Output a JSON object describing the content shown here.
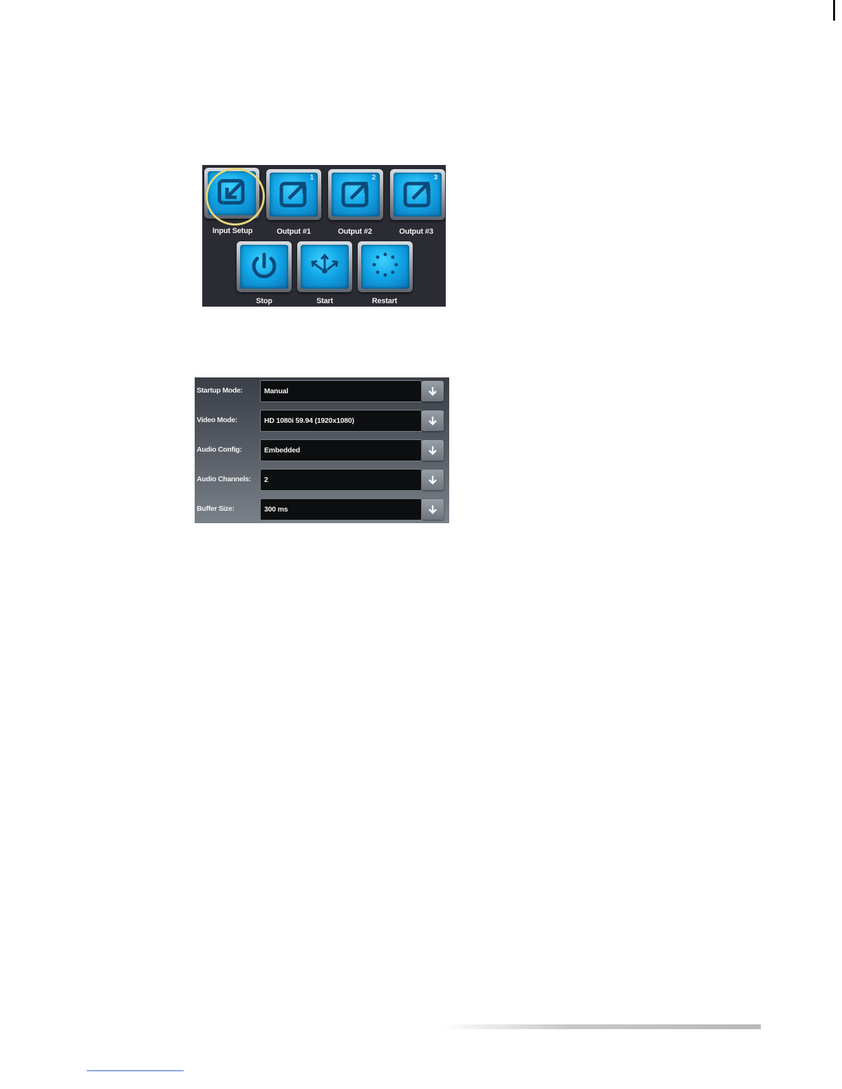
{
  "top_buttons": [
    {
      "label": "Input Setup",
      "icon": "input-arrow-icon"
    },
    {
      "label": "Output #1",
      "icon": "output-arrow-icon",
      "badge": "1"
    },
    {
      "label": "Output #2",
      "icon": "output-arrow-icon",
      "badge": "2"
    },
    {
      "label": "Output #3",
      "icon": "output-arrow-icon",
      "badge": "3"
    }
  ],
  "bottom_buttons": [
    {
      "label": "Stop",
      "icon": "power-icon"
    },
    {
      "label": "Start",
      "icon": "start-arrows-icon"
    },
    {
      "label": "Restart",
      "icon": "restart-dots-icon"
    }
  ],
  "settings": [
    {
      "label": "Startup Mode:",
      "value": "Manual"
    },
    {
      "label": "Video Mode:",
      "value": "HD 1080i 59.94 (1920x1080)"
    },
    {
      "label": "Audio Config:",
      "value": "Embedded"
    },
    {
      "label": "Audio Channels:",
      "value": "2"
    },
    {
      "label": "Buffer Size:",
      "value": "300 ms"
    }
  ],
  "colors": {
    "tile_blue": "#11a6e6",
    "panel_dark": "#2b2b33",
    "highlight": "#e6d77a"
  }
}
